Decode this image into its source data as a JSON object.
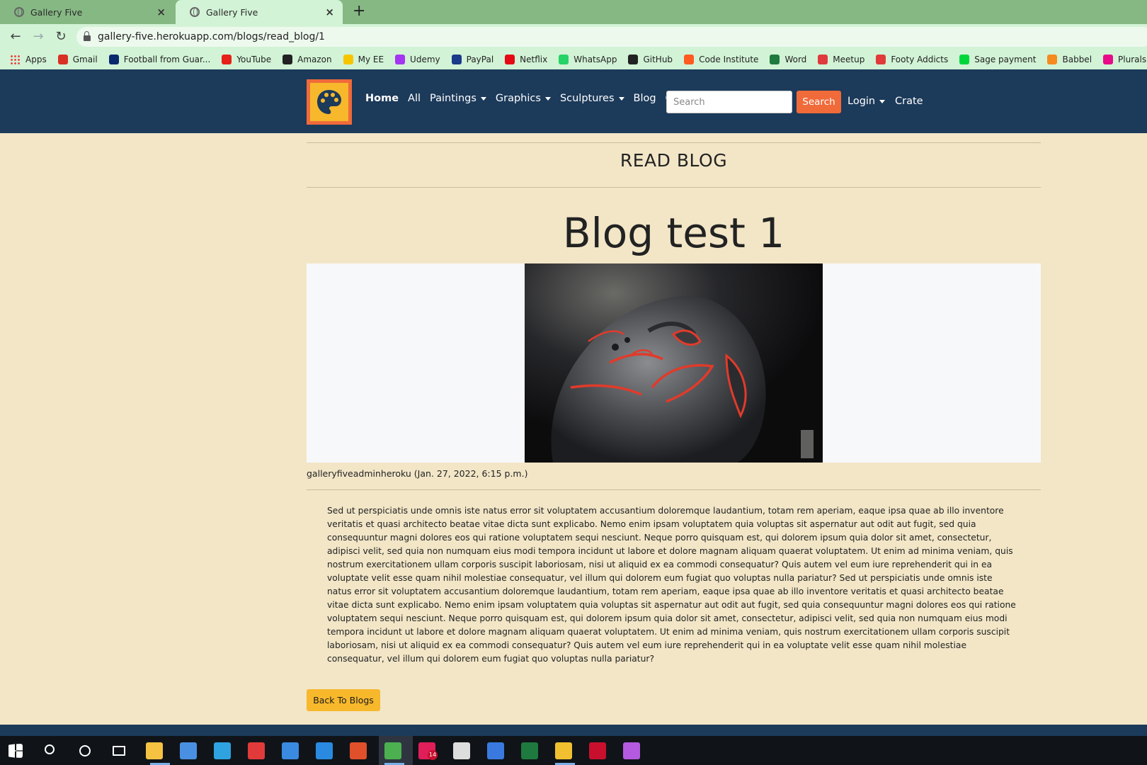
{
  "browser": {
    "tabs": [
      {
        "title": "Gallery Five",
        "active": false
      },
      {
        "title": "Gallery Five",
        "active": true
      }
    ],
    "new_tab": "+",
    "close": "×",
    "url": "gallery-five.herokuapp.com/blogs/read_blog/1",
    "bookmarks": [
      {
        "label": "Apps",
        "icon": "apps-grid-icon",
        "color": "#e44"
      },
      {
        "label": "Gmail",
        "icon": "gmail-icon",
        "color": "#d93025"
      },
      {
        "label": "Football from Guar...",
        "icon": "guardian-icon",
        "color": "#0a2a6e"
      },
      {
        "label": "YouTube",
        "icon": "youtube-icon",
        "color": "#e62117"
      },
      {
        "label": "Amazon",
        "icon": "amazon-icon",
        "color": "#222"
      },
      {
        "label": "My EE",
        "icon": "ee-icon",
        "color": "#f7c500"
      },
      {
        "label": "Udemy",
        "icon": "udemy-icon",
        "color": "#a435f0"
      },
      {
        "label": "PayPal",
        "icon": "paypal-icon",
        "color": "#1a3a8a"
      },
      {
        "label": "Netflix",
        "icon": "netflix-icon",
        "color": "#e50914"
      },
      {
        "label": "WhatsApp",
        "icon": "whatsapp-icon",
        "color": "#25d366"
      },
      {
        "label": "GitHub",
        "icon": "github-icon",
        "color": "#222"
      },
      {
        "label": "Code Institute",
        "icon": "code-institute-icon",
        "color": "#ff5a1f"
      },
      {
        "label": "Word",
        "icon": "word-icon",
        "color": "#1e7a3e"
      },
      {
        "label": "Meetup",
        "icon": "meetup-icon",
        "color": "#e0393e"
      },
      {
        "label": "Footy Addicts",
        "icon": "footy-addicts-icon",
        "color": "#e03a3a"
      },
      {
        "label": "Sage payment",
        "icon": "sage-icon",
        "color": "#00d639"
      },
      {
        "label": "Babbel",
        "icon": "babbel-icon",
        "color": "#f58a1f"
      },
      {
        "label": "Pluralsight",
        "icon": "pluralsight-icon",
        "color": "#e80a89"
      }
    ]
  },
  "navbar": {
    "links": [
      {
        "label": "Home",
        "dropdown": false,
        "bold": true
      },
      {
        "label": "All",
        "dropdown": false,
        "bold": false
      },
      {
        "label": "Paintings",
        "dropdown": true,
        "bold": false
      },
      {
        "label": "Graphics",
        "dropdown": true,
        "bold": false
      },
      {
        "label": "Sculptures",
        "dropdown": true,
        "bold": false
      },
      {
        "label": "Blog",
        "dropdown": false,
        "bold": false
      },
      {
        "label": "Contact",
        "dropdown": false,
        "bold": false
      }
    ],
    "search_placeholder": "Search",
    "search_button": "Search",
    "login": "Login",
    "crate": "Crate",
    "colors": {
      "navbar": "#1c3a5a",
      "accent": "#f06a3a",
      "logo": "#f7b82c"
    }
  },
  "page": {
    "section_title": "READ BLOG",
    "blog_title": "Blog test 1",
    "byline": "galleryfiveadminheroku (Jan. 27, 2022, 6:15 p.m.)",
    "body": "Sed ut perspiciatis unde omnis iste natus error sit voluptatem accusantium doloremque laudantium, totam rem aperiam, eaque ipsa quae ab illo inventore veritatis et quasi architecto beatae vitae dicta sunt explicabo. Nemo enim ipsam voluptatem quia voluptas sit aspernatur aut odit aut fugit, sed quia consequuntur magni dolores eos qui ratione voluptatem sequi nesciunt. Neque porro quisquam est, qui dolorem ipsum quia dolor sit amet, consectetur, adipisci velit, sed quia non numquam eius modi tempora incidunt ut labore et dolore magnam aliquam quaerat voluptatem. Ut enim ad minima veniam, quis nostrum exercitationem ullam corporis suscipit laboriosam, nisi ut aliquid ex ea commodi consequatur? Quis autem vel eum iure reprehenderit qui in ea voluptate velit esse quam nihil molestiae consequatur, vel illum qui dolorem eum fugiat quo voluptas nulla pariatur? Sed ut perspiciatis unde omnis iste natus error sit voluptatem accusantium doloremque laudantium, totam rem aperiam, eaque ipsa quae ab illo inventore veritatis et quasi architecto beatae vitae dicta sunt explicabo. Nemo enim ipsam voluptatem quia voluptas sit aspernatur aut odit aut fugit, sed quia consequuntur magni dolores eos qui ratione voluptatem sequi nesciunt. Neque porro quisquam est, qui dolorem ipsum quia dolor sit amet, consectetur, adipisci velit, sed quia non numquam eius modi tempora incidunt ut labore et dolore magnam aliquam quaerat voluptatem. Ut enim ad minima veniam, quis nostrum exercitationem ullam corporis suscipit laboriosam, nisi ut aliquid ex ea commodi consequatur? Quis autem vel eum iure reprehenderit qui in ea voluptate velit esse quam nihil molestiae consequatur, vel illum qui dolorem eum fugiat quo voluptas nulla pariatur?",
    "back_button": "Back To Blogs",
    "image_alt": "sculpture-head-photo"
  },
  "taskbar": {
    "icons": [
      {
        "name": "windows-start-icon",
        "color": "#ffffff"
      },
      {
        "name": "search-icon",
        "color": "#ffffff"
      },
      {
        "name": "cortana-icon",
        "color": "#ffffff"
      },
      {
        "name": "task-view-icon",
        "color": "#ffffff"
      },
      {
        "name": "file-explorer-icon",
        "color": "#f5c242"
      },
      {
        "name": "microsoft-store-icon",
        "color": "#4a90e2"
      },
      {
        "name": "edge-icon",
        "color": "#2ea3e0"
      },
      {
        "name": "gift-icon",
        "color": "#e03a3a"
      },
      {
        "name": "mail-icon",
        "color": "#3a8ae0"
      },
      {
        "name": "vscode-icon",
        "color": "#2a8ae0"
      },
      {
        "name": "office-icon",
        "color": "#e0502a"
      },
      {
        "name": "chrome-icon",
        "color": "#4caf50"
      },
      {
        "name": "slack-icon",
        "color": "#e01e5a"
      },
      {
        "name": "emoji-icon",
        "color": "#dddddd"
      },
      {
        "name": "photos-icon",
        "color": "#3a7ae0"
      },
      {
        "name": "excel-icon",
        "color": "#1e7a3e"
      },
      {
        "name": "security-shield-icon",
        "color": "#f0c030"
      },
      {
        "name": "mcafee-icon",
        "color": "#c8102e"
      },
      {
        "name": "paint-drop-icon",
        "color": "#b45ae0"
      }
    ],
    "slack_badge": "14"
  }
}
